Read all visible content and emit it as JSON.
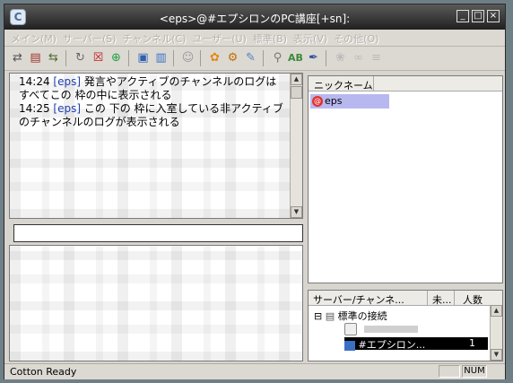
{
  "window": {
    "title": "<eps>@#エプシロンのPC講座[+sn]:",
    "app_icon": "C"
  },
  "menu": [
    "メイン(M)",
    "サーバー(S)",
    "チャンネル(C)",
    "ユーザー(U)",
    "標準(B)",
    "表示(V)",
    "その他(O)"
  ],
  "toolbar_icons": [
    "connect-icon",
    "server-icon",
    "disconnect-icon",
    "reload-icon",
    "close-x-icon",
    "add-icon",
    "save-icon",
    "log-icon",
    "mask-icon",
    "flower-icon",
    "gear-icon",
    "edit-icon",
    "search-icon",
    "font-icon",
    "pen-icon",
    "paw-icon",
    "link-icon",
    "tools-icon"
  ],
  "log": [
    {
      "time": "14:24",
      "nick": "[eps]",
      "text": "発言やアクティブのチャンネルのログはすべてこの 枠の中に表示される"
    },
    {
      "time": "14:25",
      "nick": "[eps]",
      "text": "この 下の 枠に入室している非アクティブのチャンネルのログが表示される"
    }
  ],
  "nicklist": {
    "header": "ニックネーム",
    "users": [
      {
        "name": "eps",
        "mode_icon": "operator-icon"
      }
    ]
  },
  "servers": {
    "headers": [
      "サーバー/チャンネ...",
      "未...",
      "人数"
    ],
    "group": "標準の接続",
    "server_name_blurred": "",
    "channel": "#エプシロン...",
    "channel_count": "1"
  },
  "status": {
    "text": "Cotton Ready",
    "num": "NUM"
  },
  "colors": {
    "titlebar": "#202020",
    "selection": "#b8b8f0",
    "nick_color": "#2040b0"
  }
}
